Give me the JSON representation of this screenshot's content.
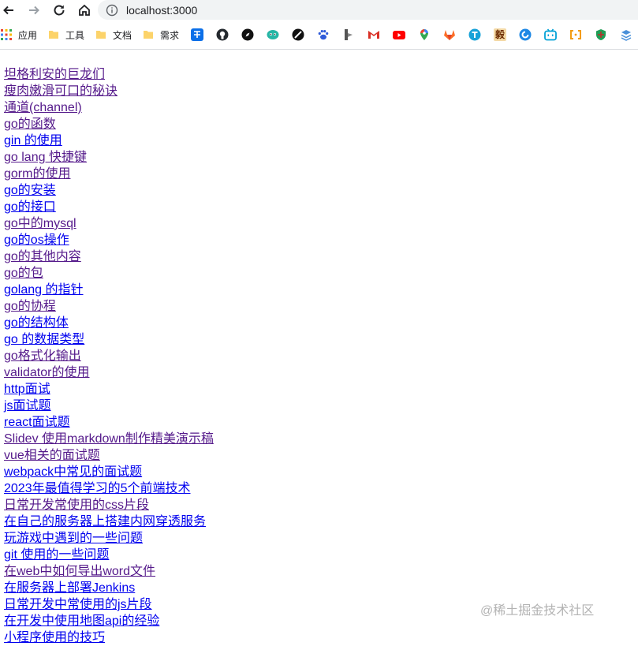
{
  "browser": {
    "url": "localhost:3000",
    "bookmarks": [
      {
        "icon": "apps-grid-icon",
        "label": "应用"
      },
      {
        "icon": "folder-icon",
        "label": "工具"
      },
      {
        "icon": "folder-icon",
        "label": "文档"
      },
      {
        "icon": "folder-icon",
        "label": "需求"
      },
      {
        "icon": "zhihu-icon",
        "label": ""
      },
      {
        "icon": "github-icon",
        "label": ""
      },
      {
        "icon": "compass-icon",
        "label": ""
      },
      {
        "icon": "mascot-icon",
        "label": ""
      },
      {
        "icon": "blocked-circle-icon",
        "label": ""
      },
      {
        "icon": "paw-icon",
        "label": ""
      },
      {
        "icon": "lightning-icon",
        "label": ""
      },
      {
        "icon": "gmail-icon",
        "label": ""
      },
      {
        "icon": "youtube-icon",
        "label": ""
      },
      {
        "icon": "maps-pin-icon",
        "label": ""
      },
      {
        "icon": "gitlab-icon",
        "label": ""
      },
      {
        "icon": "translate-icon",
        "label": ""
      },
      {
        "icon": "chinese-character-icon",
        "label": "毅"
      },
      {
        "icon": "swirl-icon",
        "label": ""
      },
      {
        "icon": "bilibili-icon",
        "label": ""
      },
      {
        "icon": "bracket-icon",
        "label": ""
      },
      {
        "icon": "shield-green-icon",
        "label": ""
      },
      {
        "icon": "stack-icon",
        "label": ""
      }
    ]
  },
  "links": [
    {
      "text": "坦格利安的巨龙们",
      "visited": true
    },
    {
      "text": "瘦肉嫩滑可口的秘诀",
      "visited": true
    },
    {
      "text": "通道(channel)",
      "visited": true
    },
    {
      "text": "go的函数",
      "visited": true
    },
    {
      "text": "gin 的使用",
      "visited": false
    },
    {
      "text": "go lang 快捷键",
      "visited": true
    },
    {
      "text": "gorm的使用",
      "visited": true
    },
    {
      "text": "go的安装",
      "visited": false
    },
    {
      "text": "go的接口",
      "visited": false
    },
    {
      "text": "go中的mysql",
      "visited": true
    },
    {
      "text": "go的os操作",
      "visited": false
    },
    {
      "text": "go的其他内容",
      "visited": true
    },
    {
      "text": "go的包",
      "visited": true
    },
    {
      "text": "golang 的指针",
      "visited": false
    },
    {
      "text": "go的协程",
      "visited": true
    },
    {
      "text": "go的结构体",
      "visited": false
    },
    {
      "text": "go 的数据类型",
      "visited": false
    },
    {
      "text": "go格式化输出",
      "visited": true
    },
    {
      "text": "validator的使用",
      "visited": true
    },
    {
      "text": "http面试",
      "visited": false
    },
    {
      "text": "js面试题",
      "visited": false
    },
    {
      "text": "react面试题",
      "visited": false
    },
    {
      "text": "Slidev 使用markdown制作精美演示稿",
      "visited": true
    },
    {
      "text": "vue相关的面试题",
      "visited": true
    },
    {
      "text": "webpack中常见的面试题",
      "visited": false
    },
    {
      "text": "2023年最值得学习的5个前端技术",
      "visited": false
    },
    {
      "text": "日常开发常使用的css片段",
      "visited": true
    },
    {
      "text": "在自己的服务器上搭建内网穿透服务",
      "visited": false
    },
    {
      "text": "玩游戏中遇到的一些问题",
      "visited": false
    },
    {
      "text": "git 使用的一些问题",
      "visited": false
    },
    {
      "text": "在web中如何导出word文件",
      "visited": true
    },
    {
      "text": "在服务器上部署Jenkins",
      "visited": false
    },
    {
      "text": "日常开发中常使用的js片段",
      "visited": false
    },
    {
      "text": "在开发中使用地图api的经验",
      "visited": false
    },
    {
      "text": "小程序使用的技巧",
      "visited": false
    }
  ],
  "watermark": "@稀土掘金技术社区",
  "colors": {
    "link": "#0000ee",
    "visited": "#551a8b",
    "watermark": "#b3b3b3",
    "omnibox_bg": "#f1f3f4"
  }
}
